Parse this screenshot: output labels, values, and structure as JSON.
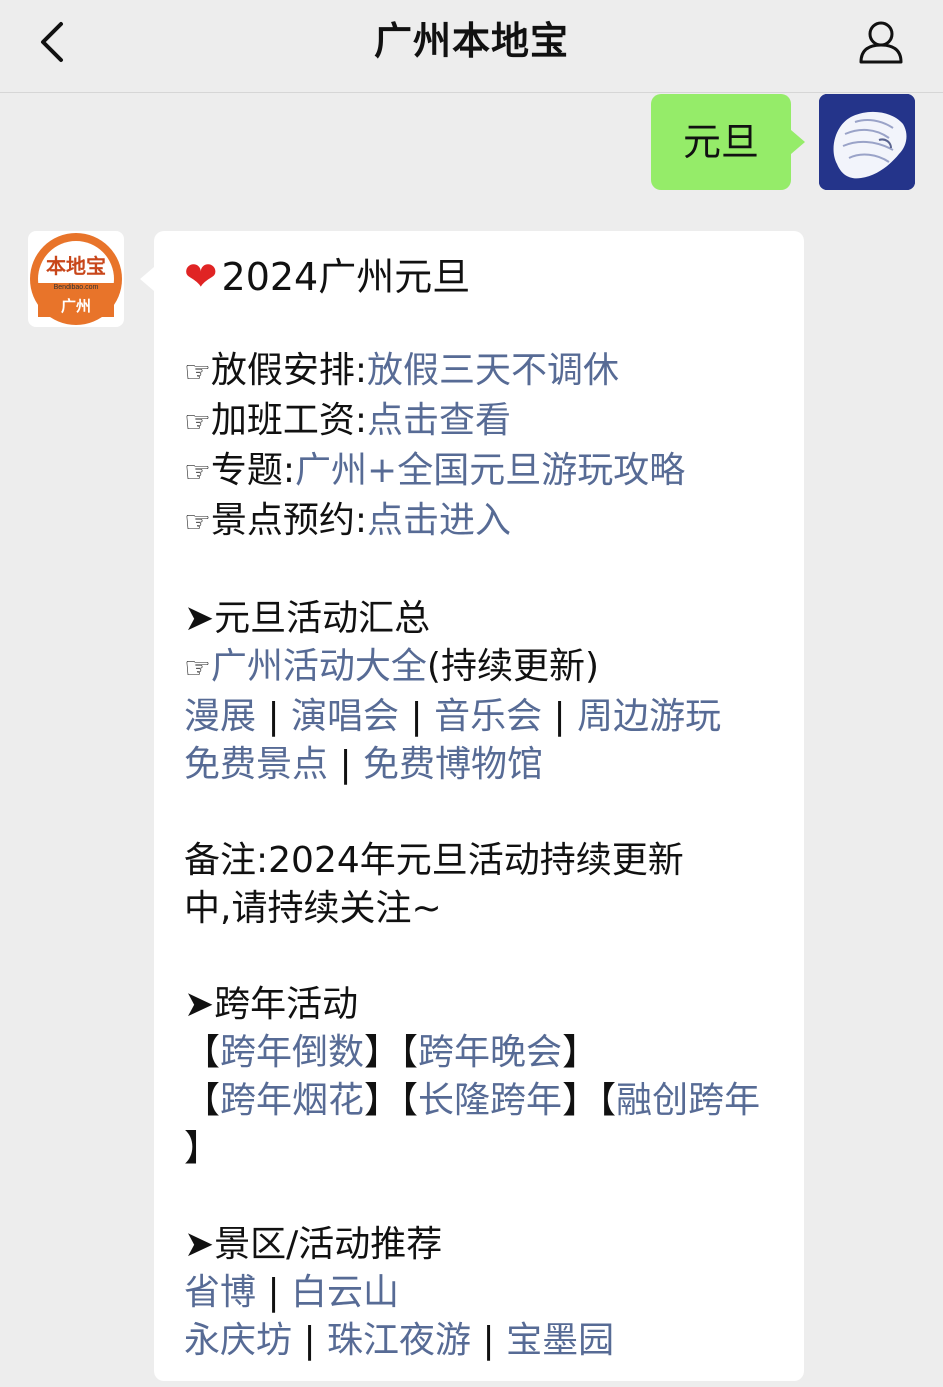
{
  "header": {
    "title": "广州本地宝",
    "back_icon": "chevron-left-icon",
    "profile_icon": "person-icon"
  },
  "outgoing": {
    "text": "元旦",
    "bubble_color": "#95ec69"
  },
  "incoming": {
    "avatar": {
      "brand": "本地宝",
      "domain": "Bendibao.com",
      "city": "广州",
      "color": "#e8742a"
    },
    "heart_title": "2024广州元旦",
    "hand_glyph": "☞",
    "arrow_glyph": "➤",
    "items": [
      {
        "label": "放假安排:",
        "link": "放假三天不调休"
      },
      {
        "label": "加班工资:",
        "link": "点击查看"
      },
      {
        "label": "专题:",
        "link": "广州+全国元旦游玩攻略"
      },
      {
        "label": "景点预约:",
        "link": "点击进入"
      }
    ],
    "summary_heading": "元旦活动汇总",
    "activities_link": "广州活动大全",
    "activities_note": "(持续更新)",
    "row1": [
      "漫展",
      "演唱会",
      "音乐会",
      "周边游玩"
    ],
    "row2": [
      "免费景点",
      "免费博物馆"
    ],
    "note_line1": "备注:2024年元旦活动持续更新",
    "note_line2": "中,请持续关注~",
    "newyear_heading": "跨年活动",
    "newyear_row1": [
      "跨年倒数",
      "跨年晚会"
    ],
    "newyear_row2": [
      "跨年烟花",
      "长隆跨年",
      "融创跨年"
    ],
    "newyear_tail": "】",
    "recommend_heading": "景区/活动推荐",
    "rec_row1": [
      "省博",
      "白云山"
    ],
    "rec_row2": [
      "永庆坊",
      "珠江夜游",
      "宝墨园"
    ],
    "link_color": "#576b95"
  }
}
